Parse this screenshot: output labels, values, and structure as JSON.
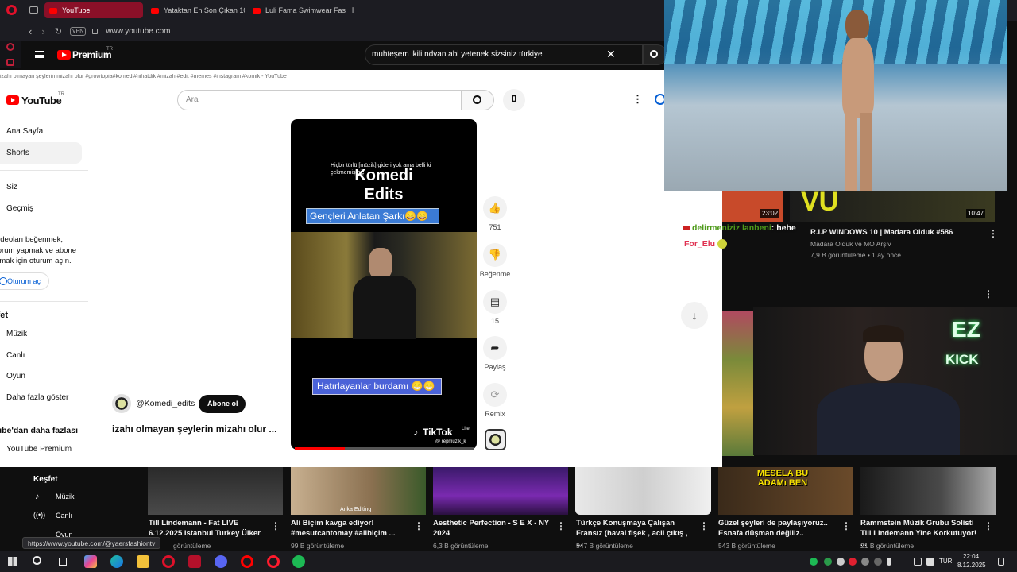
{
  "browser": {
    "tabs": [
      {
        "label": "YouTube"
      },
      {
        "label": "Yataktan En Son Çıkan 10..."
      },
      {
        "label": "Luli Fama Swimwear Fash..."
      }
    ],
    "vpn_label": "VPN",
    "url": "www.youtube.com",
    "status_url": "https://www.youtube.com/@yaersfashiontv"
  },
  "yt_main": {
    "logo_text": "Premium",
    "region": "TR",
    "search_value": "muhteşem ikili ndvan abi yetenek sizsiniz türkiye"
  },
  "popup": {
    "window_title": "izahı olmayan şeylerin mizahı olur #growtopia#komedi#nihatdik #mizah #edit #memes #instagram #komik - YouTube",
    "logo_text": "YouTube",
    "region": "TR",
    "search_placeholder": "Ara",
    "sidebar": {
      "home": "Ana Sayfa",
      "shorts": "Shorts",
      "you": "Siz",
      "history": "Geçmiş",
      "login_prompt": "Videoları beğenmek, yorum yapmak ve abone olmak için oturum açın.",
      "login_button": "Oturum aç",
      "explore_heading": "Keşfet",
      "music": "Müzik",
      "live": "Canlı",
      "gaming": "Oyun",
      "show_more": "Daha fazla göster",
      "more_from": "YouTube'dan daha fazlası",
      "premium": "YouTube Premium"
    },
    "short": {
      "caption_small": "Hiçbir türlü [müzik] gideri yok ama belli ki çekmemiş hiç",
      "title_overlay_1": "Komedi",
      "title_overlay_2": "Edits",
      "banner_top": "Gençleri Anlatan Şarkı😄😄",
      "banner_bottom": "Hatırlayanlar burdamı 😁😁",
      "watermark": "TikTok",
      "watermark_lite": "Lite",
      "watermark_user": "@ repmuzik_k",
      "channel": "@Komedi_edits",
      "subscribe": "Abone ol",
      "title": "izahı olmayan şeylerin mizahı olur ..."
    },
    "actions": {
      "likes": "751",
      "dislike": "Beğenme",
      "comments": "15",
      "share": "Paylaş",
      "remix": "Remix"
    }
  },
  "chat": {
    "messages": [
      {
        "user": "delirmeniziz lanbeni",
        "text": ": hehe"
      },
      {
        "user": "For_Elu",
        "text": ""
      }
    ]
  },
  "right_videos": {
    "duration_1": "23:02",
    "duration_2": "10:47",
    "title": "R.I.P WINDOWS 10 | Madara Olduk #586",
    "channel": "Madara Olduk ve MO Arşiv",
    "meta": "7,9 B görüntüleme • 1 ay önce"
  },
  "webcam": {
    "neon_1": "EZ",
    "neon_2": "KICK"
  },
  "bottom_sidebar": {
    "explore": "Keşfet",
    "music": "Müzik",
    "live": "Canlı",
    "gaming": "Oyun"
  },
  "bottom_videos": [
    {
      "title": "Till Lindemann - Fat LIVE 6.12.2025 Istanbul Turkey Ülker ...",
      "views": "görüntüleme"
    },
    {
      "title": "Ali Biçim kavga ediyor! #mesutcantomay #alibiçim ...",
      "views": "99 B görüntüleme",
      "overlay": "Anka Editing"
    },
    {
      "title": "Aesthetic Perfection - S E X - NY 2024",
      "views": "6,3 B görüntüleme"
    },
    {
      "title": "Türkçe Konuşmaya Çalışan Fransız (havai fişek , acil çıkış , ...",
      "views": "547 B görüntüleme"
    },
    {
      "title": "Güzel şeyleri de paylaşıyoruz.. Esnafa düşman değiliz..",
      "views": "543 B görüntüleme",
      "overlay": "MESELA BU ADAMı BEN"
    },
    {
      "title": "Rammstein Müzik Grubu Solisti Till Lindemann Yine Korkutuyor! ...",
      "views": "21 B görüntüleme"
    }
  ],
  "taskbar": {
    "language": "TUR",
    "time": "22:04",
    "date": "8.12.2025"
  }
}
